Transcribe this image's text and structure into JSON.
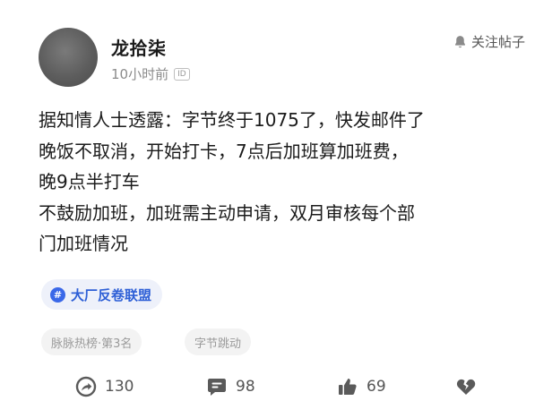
{
  "post": {
    "author": {
      "name": "龙拾柒",
      "time": "10小时前",
      "id_badge": "ID"
    },
    "follow_label": "关注帖子",
    "content_lines": [
      "据知情人士透露：字节终于1075了，快发邮件了",
      "晚饭不取消，开始打卡，7点后加班算加班费，",
      "晚9点半打车",
      "不鼓励加班，加班需主动申请，双月审核每个部",
      "门加班情况"
    ],
    "circle_tag": {
      "icon": "hash-icon",
      "label": "大厂反卷联盟"
    },
    "tags": [
      "脉脉热榜·第3名",
      "字节跳动"
    ],
    "actions": {
      "share_count": "130",
      "comment_count": "98",
      "like_count": "69"
    }
  },
  "colors": {
    "accent": "#2d5fd6",
    "tag_bg": "#eef1fa",
    "icon_gray": "#5a5a5a"
  }
}
